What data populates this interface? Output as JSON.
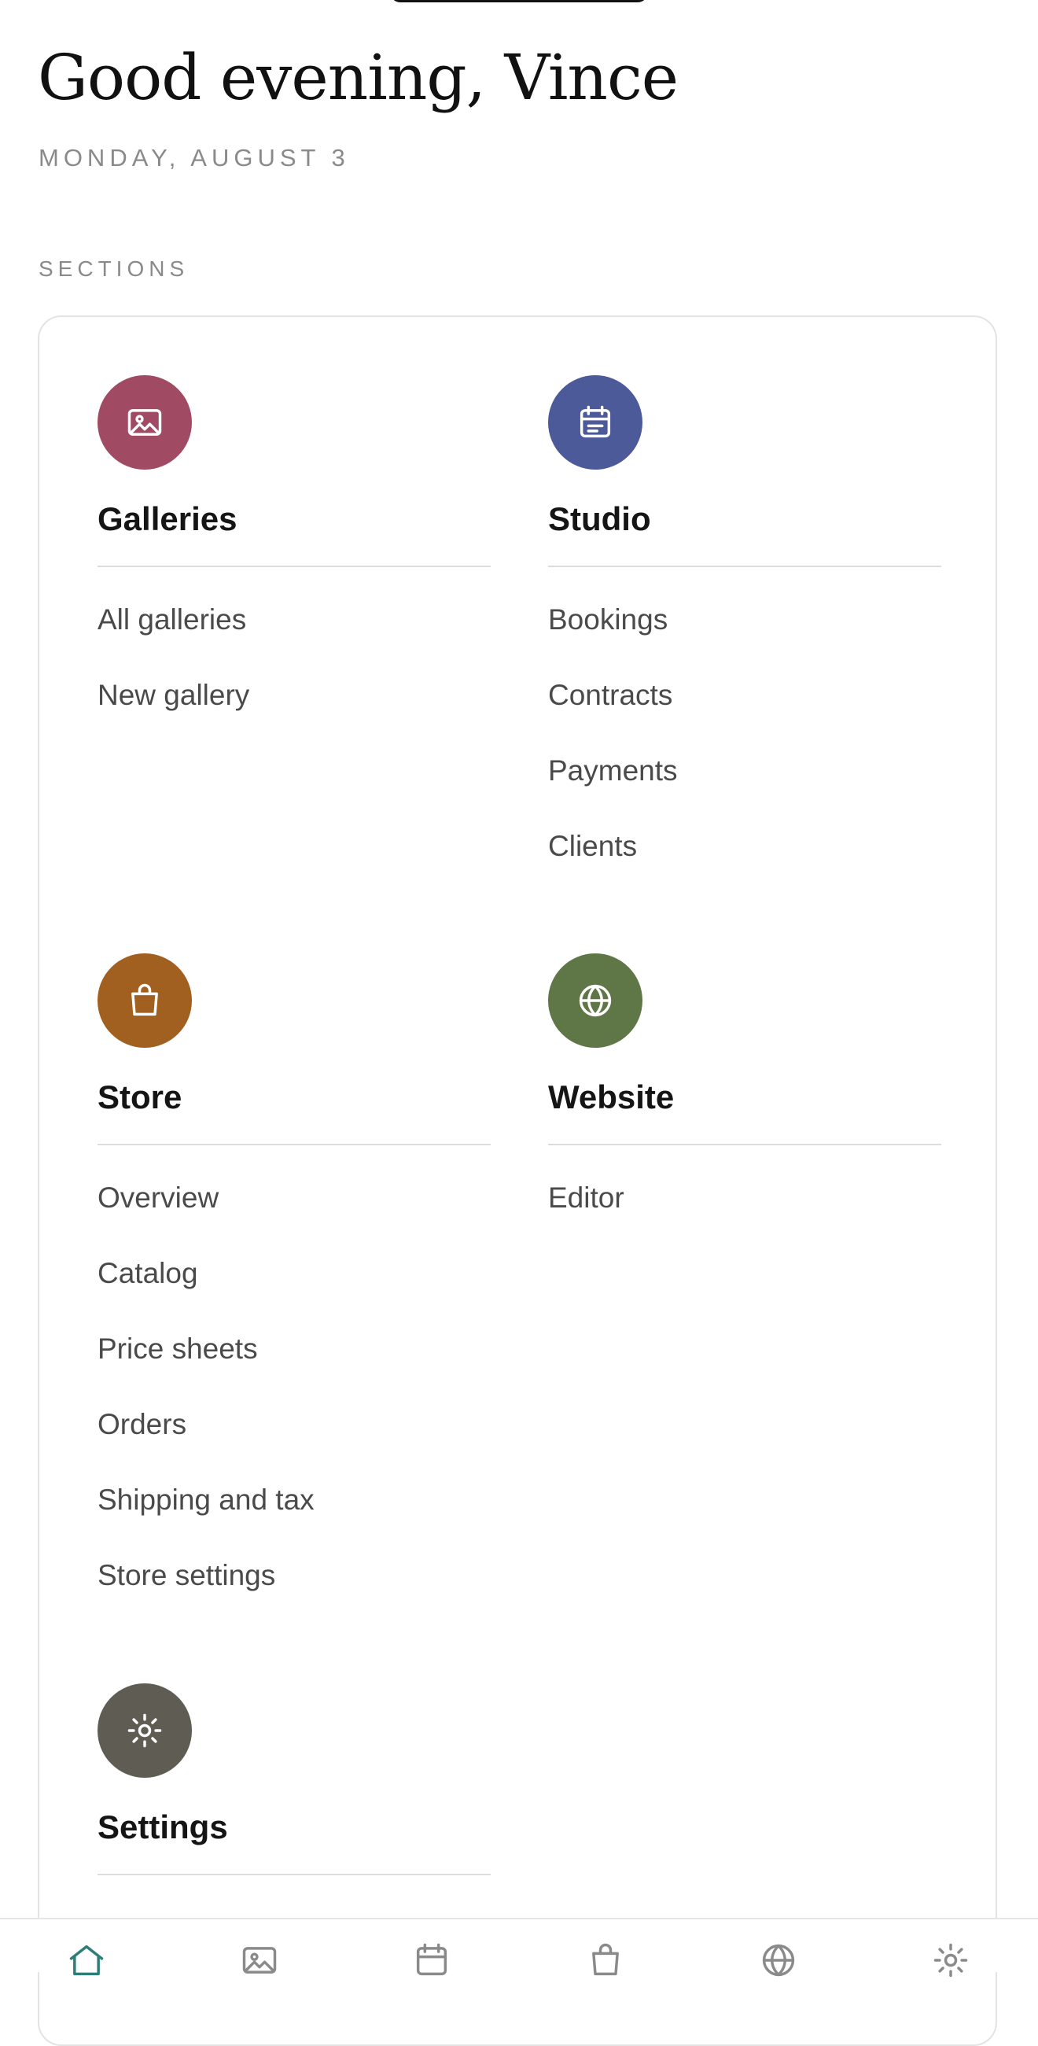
{
  "header": {
    "greeting": "Good evening, Vince",
    "date": "MONDAY, AUGUST 3"
  },
  "sections_label": "SECTIONS",
  "sections": [
    {
      "title": "Galleries",
      "icon": "image-icon",
      "color": "#a04a64",
      "items": [
        "All galleries",
        "New gallery"
      ]
    },
    {
      "title": "Studio",
      "icon": "calendar-icon",
      "color": "#4c5a9a",
      "items": [
        "Bookings",
        "Contracts",
        "Payments",
        "Clients"
      ]
    },
    {
      "title": "Store",
      "icon": "shopping-bag-icon",
      "color": "#a16020",
      "items": [
        "Overview",
        "Catalog",
        "Price sheets",
        "Orders",
        "Shipping and tax",
        "Store settings"
      ]
    },
    {
      "title": "Website",
      "icon": "globe-icon",
      "color": "#5f7646",
      "items": [
        "Editor"
      ]
    },
    {
      "title": "Settings",
      "icon": "gear-icon",
      "color": "#5f5d53",
      "items": []
    }
  ],
  "bottom_nav": [
    {
      "icon": "home-icon",
      "active": true
    },
    {
      "icon": "image-icon",
      "active": false
    },
    {
      "icon": "calendar-icon",
      "active": false
    },
    {
      "icon": "shopping-bag-icon",
      "active": false
    },
    {
      "icon": "globe-icon",
      "active": false
    },
    {
      "icon": "gear-icon",
      "active": false
    }
  ],
  "colors": {
    "nav_active": "#2e7d78",
    "nav_inactive": "#8a8a8a"
  }
}
